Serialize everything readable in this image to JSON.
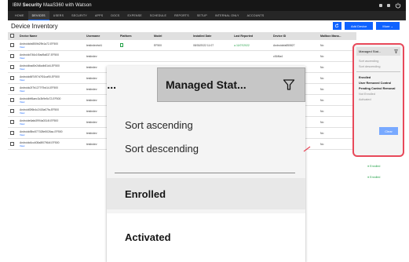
{
  "topbar": {
    "brand_prefix": "IBM ",
    "brand_bold": "Security",
    "brand_rest": " MaaS360 with Watson"
  },
  "nav": [
    {
      "label": "HOME",
      "active": false
    },
    {
      "label": "DEVICES",
      "active": true
    },
    {
      "label": "USERS",
      "active": false
    },
    {
      "label": "SECURITY",
      "active": false
    },
    {
      "label": "APPS",
      "active": false
    },
    {
      "label": "DOCS",
      "active": false
    },
    {
      "label": "EXPENSE",
      "active": false
    },
    {
      "label": "SCHEDULE",
      "active": false
    },
    {
      "label": "REPORTS",
      "active": false
    },
    {
      "label": "SETUP",
      "active": false
    },
    {
      "label": "INTERNAL ONLY",
      "active": false
    },
    {
      "label": "ACCOUNTS",
      "active": false
    }
  ],
  "header": {
    "title": "Device Inventory",
    "add_device": "Add Device",
    "more": "More ⌄"
  },
  "table": {
    "columns": [
      "Device Name",
      "Username",
      "Platform",
      "Model",
      "Installed Date",
      "Last Reported",
      "Device ID",
      "Mailbox Mana..."
    ],
    "rows": [
      {
        "name": "Androidcfa850fd29b1a72-EF500",
        "user": "testindevbot1",
        "model": "EF500",
        "installed": "08/30/2022 11:07",
        "last": "11/07/2022",
        "devid": "Androidcfa850827",
        "mail": "No"
      },
      {
        "name": "Androidd746c1f0ad9a837-EF500",
        "user": "testindev",
        "model": "",
        "installed": "",
        "last": "",
        "devid": "c51f6a4",
        "mail": "No"
      },
      {
        "name": "Androidbad0e2d6cdb81d4-EF500",
        "user": "testindev",
        "model": "",
        "installed": "",
        "last": "",
        "devid": "a1d4cd0",
        "mail": "No"
      },
      {
        "name": "Androidd6f7497d7f01ca90-EF500",
        "user": "testindev",
        "model": "",
        "installed": "",
        "last": "",
        "devid": "a4f97d7",
        "mail": "No"
      },
      {
        "name": "Androidc2f7b1277f7bd14-EF500",
        "user": "testindev",
        "model": "",
        "installed": "",
        "last": "",
        "devid": "cd127f7",
        "mail": "No"
      },
      {
        "name": "Androidbff4aec3c3b9e5c72-EF500",
        "user": "testindev",
        "model": "",
        "installed": "",
        "last": "",
        "devid": "ec3c3b",
        "mail": "No"
      },
      {
        "name": "Androidf2f6b4c2415a07fa-EF500",
        "user": "testindev",
        "model": "",
        "installed": "",
        "last": "",
        "devid": "d2415",
        "mail": "No"
      },
      {
        "name": "Androide6afa3994a0314f-EF500",
        "user": "testindev",
        "model": "",
        "installed": "",
        "last": "",
        "devid": "a3994a",
        "mail": "No"
      },
      {
        "name": "Androidd5bc577028e5026ac-EF500",
        "user": "testindev",
        "model": "",
        "installed": "",
        "last": "",
        "devid": "577028",
        "mail": "No"
      },
      {
        "name": "Androidc6cc408a8f07964f-EF500",
        "user": "testindev",
        "model": "",
        "installed": "",
        "last": "",
        "devid": "408a8f",
        "mail": "No"
      }
    ],
    "view_label": "View"
  },
  "status_cells": [
    "Enrolled",
    "Enrolled"
  ],
  "small_dropdown": {
    "header": "Managed Stat...",
    "sort_asc": "Sort ascending",
    "sort_desc": "Sort descending",
    "options": [
      "Enrolled",
      "User Removed Control",
      "Pending Control Removal",
      "Not Enrolled",
      "Activated"
    ],
    "clear": "Clear"
  },
  "big_dropdown": {
    "dots": "...",
    "title": "Managed Stat...",
    "sort_asc": "Sort ascending",
    "sort_desc": "Sort descending",
    "opt1": "Enrolled",
    "opt2": "Activated"
  },
  "colors": {
    "accent": "#0f62fe",
    "highlight": "#e8495a",
    "success": "#24a148",
    "topbar": "#161616"
  }
}
